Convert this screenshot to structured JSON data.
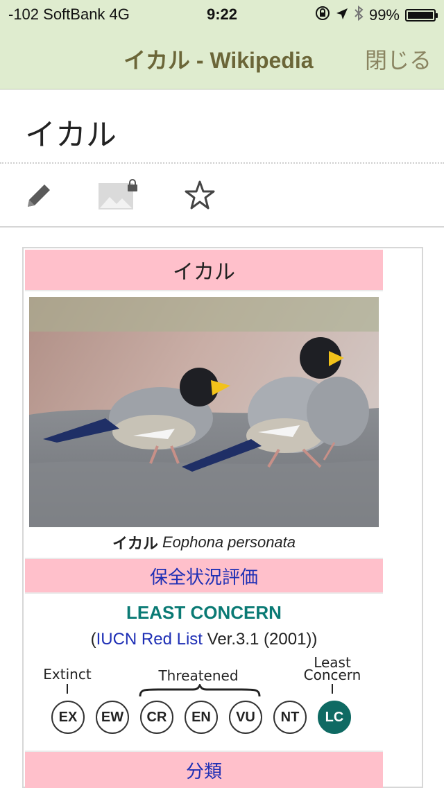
{
  "status": {
    "carrier": "-102 SoftBank   4G",
    "time": "9:22",
    "battery": "99%"
  },
  "nav": {
    "title": "イカル - Wikipedia",
    "close": "閉じる"
  },
  "page": {
    "title": "イカル"
  },
  "toolbar": {
    "edit_icon": "pencil-icon",
    "image_icon": "image-lock-icon",
    "star_icon": "star-icon"
  },
  "infobox": {
    "header": "イカル",
    "caption_bold": "イカル",
    "caption_italic": "Eophona personata",
    "section1": "保全状況評価",
    "status_text": "LEAST CONCERN",
    "iucn_open": "(",
    "iucn_link": "IUCN Red List",
    "iucn_rest": " Ver.3.1 (2001))",
    "labels": {
      "extinct": "Extinct",
      "threatened": "Threatened",
      "least1": "Least",
      "least2": "Concern"
    },
    "categories": [
      "EX",
      "EW",
      "CR",
      "EN",
      "VU",
      "NT",
      "LC"
    ],
    "active_category": "LC",
    "section2": "分類"
  }
}
